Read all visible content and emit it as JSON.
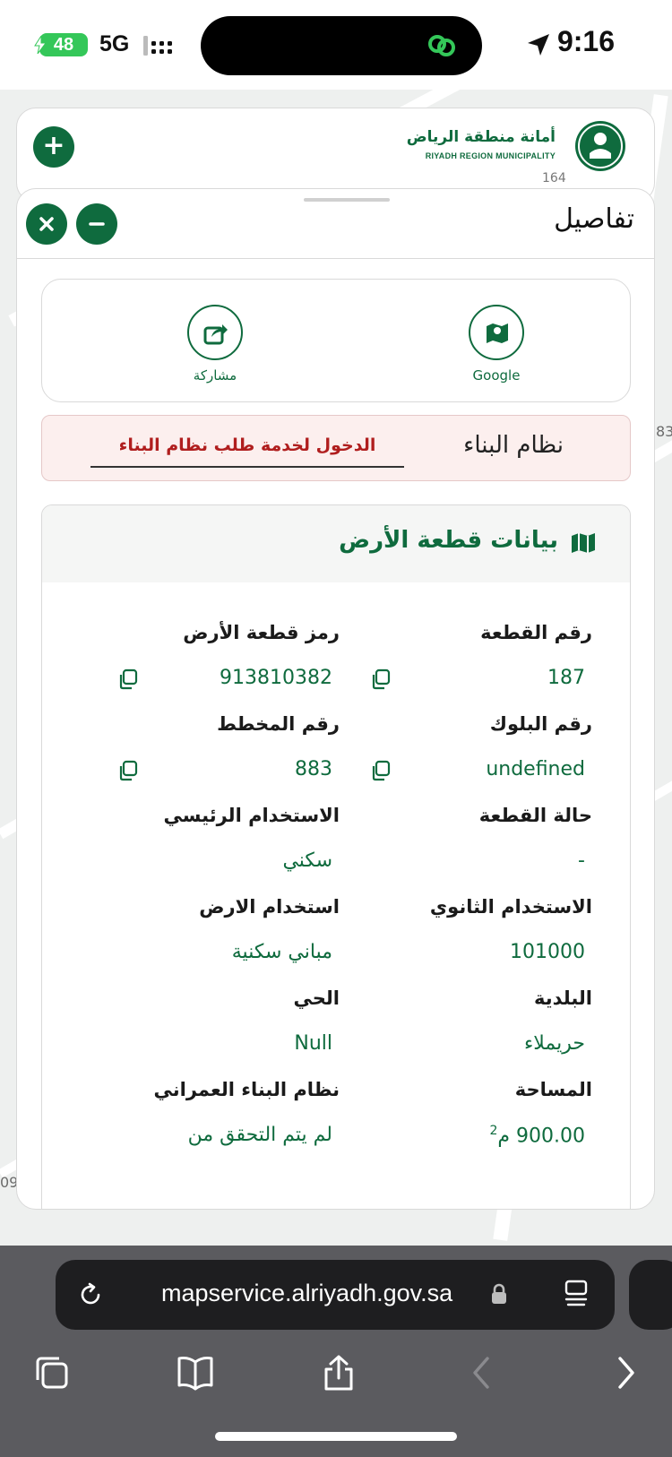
{
  "status_bar": {
    "battery": "48",
    "network": "5G",
    "time": "9:16"
  },
  "header": {
    "logo_ar": "أمانة منطقة الرياض",
    "logo_en": "RIYADH REGION MUNICIPALITY",
    "map_number": "164",
    "add_button": "+"
  },
  "map": {
    "edge_right": "83",
    "edge_left": "09"
  },
  "details": {
    "title": "تفاصيل",
    "actions": {
      "google_label": "Google",
      "share_label": "مشاركة"
    },
    "building_system": {
      "title": "نظام البناء",
      "link": "الدخول لخدمة طلب نظام البناء"
    },
    "land": {
      "title": "بيانات قطعة الأرض",
      "fields": {
        "plot_number": {
          "label": "رقم القطعة",
          "value": "187"
        },
        "plot_code": {
          "label": "رمز قطعة الأرض",
          "value": "913810382"
        },
        "block_number": {
          "label": "رقم البلوك",
          "value": "undefined"
        },
        "plan_number": {
          "label": "رقم المخطط",
          "value": "883"
        },
        "plot_status": {
          "label": "حالة القطعة",
          "value": "-"
        },
        "main_use": {
          "label": "الاستخدام الرئيسي",
          "value": "سكني"
        },
        "secondary_use": {
          "label": "الاستخدام الثانوي",
          "value": "101000"
        },
        "land_use": {
          "label": "استخدام الارض",
          "value": "مباني سكنية"
        },
        "municipality": {
          "label": "البلدية",
          "value": "حريملاء"
        },
        "district": {
          "label": "الحي",
          "value": "Null"
        },
        "area": {
          "label": "المساحة",
          "value": "900.00 م",
          "unit_sup": "2"
        },
        "urban_system": {
          "label": "نظام البناء العمراني",
          "value": "لم يتم التحقق من"
        }
      }
    }
  },
  "browser": {
    "url": "mapservice.alriyadh.gov.sa"
  },
  "colors": {
    "brand_green": "#0f6b3e",
    "alert_red": "#b01e1e",
    "alert_bg": "#fcefee"
  }
}
